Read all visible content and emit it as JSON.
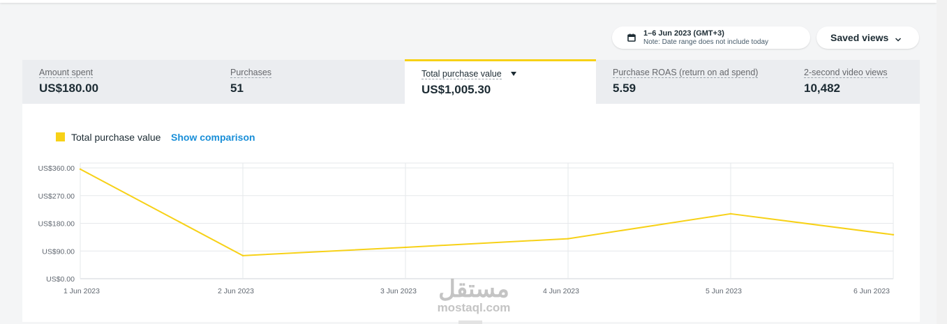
{
  "header": {
    "date_range": "1–6 Jun 2023 (GMT+3)",
    "date_note": "Note: Date range does not include today",
    "saved_views_label": "Saved views"
  },
  "metrics": [
    {
      "label": "Amount spent",
      "value": "US$180.00"
    },
    {
      "label": "Purchases",
      "value": "51"
    },
    {
      "label": "Total purchase value",
      "value": "US$1,005.30"
    },
    {
      "label": "Purchase ROAS (return on ad spend)",
      "value": "5.59"
    },
    {
      "label": "2-second video views",
      "value": "10,482"
    }
  ],
  "active_metric_index": 2,
  "legend": {
    "series_label": "Total purchase value",
    "comparison_link": "Show comparison"
  },
  "colors": {
    "accent": "#f7d117",
    "link": "#1a8fd8"
  },
  "watermark": {
    "arabic": "مستقل",
    "latin": "mostaql.com"
  },
  "chart_data": {
    "type": "line",
    "x": [
      "1 Jun 2023",
      "2 Jun 2023",
      "3 Jun 2023",
      "4 Jun 2023",
      "5 Jun 2023",
      "6 Jun 2023"
    ],
    "series": [
      {
        "name": "Total purchase value",
        "values": [
          356,
          75,
          102,
          130,
          211,
          143
        ]
      }
    ],
    "yticks": [
      0,
      90,
      180,
      270,
      360
    ],
    "ytick_labels": [
      "US$0.00",
      "US$90.00",
      "US$180.00",
      "US$270.00",
      "US$360.00"
    ],
    "ylim": [
      0,
      360
    ],
    "grid": true,
    "title": "",
    "xlabel": "",
    "ylabel": ""
  }
}
